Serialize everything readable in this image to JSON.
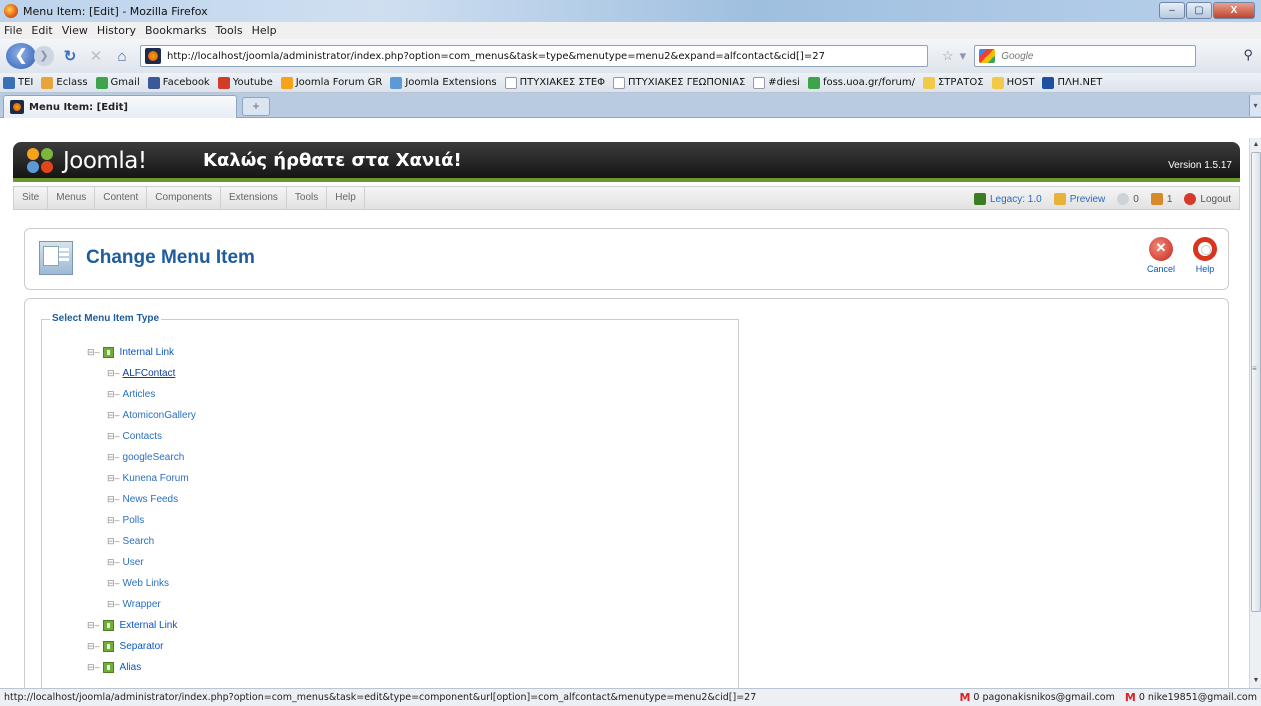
{
  "window": {
    "title": "Menu Item: [Edit] - Mozilla Firefox",
    "controls": [
      "–",
      "▢",
      "X"
    ]
  },
  "menubar": [
    "File",
    "Edit",
    "View",
    "History",
    "Bookmarks",
    "Tools",
    "Help"
  ],
  "navbar": {
    "url": "http://localhost/joomla/administrator/index.php?option=com_menus&task=type&menutype=menu2&expand=alfcontact&cid[]=27",
    "search_placeholder": "Google"
  },
  "bookmarks": [
    {
      "label": "TEI",
      "color": "#3b6fb6"
    },
    {
      "label": "Eclass",
      "color": "#e8a33b"
    },
    {
      "label": "Gmail",
      "color": "#3ea34a"
    },
    {
      "label": "Facebook",
      "color": "#3b5998"
    },
    {
      "label": "Youtube",
      "color": "#d23a2a"
    },
    {
      "label": "Joomla Forum GR",
      "color": "#f6a21a"
    },
    {
      "label": "Joomla Extensions",
      "color": "#5b9ad4"
    },
    {
      "label": "ΠΤΥΧΙΑΚΕΣ ΣΤΕΦ",
      "color": "#ffffff"
    },
    {
      "label": "ΠΤΥΧΙΑΚΕΣ ΓΕΩΠΟΝΙΑΣ",
      "color": "#ffffff"
    },
    {
      "label": "#diesi",
      "color": "#ffffff"
    },
    {
      "label": "foss.uoa.gr/forum/",
      "color": "#3ea34a"
    },
    {
      "label": "ΣΤΡΑΤΟΣ",
      "color": "#f3c94a"
    },
    {
      "label": "HOST",
      "color": "#f3c94a"
    },
    {
      "label": "ΠΛΗ.ΝΕΤ",
      "color": "#1f4fa0"
    }
  ],
  "tab": {
    "label": "Menu Item: [Edit]",
    "new_tab": "+"
  },
  "joomla": {
    "logo": "Joomla!",
    "site_name": "Καλώς ήρθατε στα Χανιά!",
    "version": "Version 1.5.17",
    "menu": [
      "Site",
      "Menus",
      "Content",
      "Components",
      "Extensions",
      "Tools",
      "Help"
    ],
    "status": {
      "legacy": "Legacy: 1.0",
      "preview": "Preview",
      "messages": "0",
      "users": "1",
      "logout": "Logout"
    }
  },
  "toolbar": {
    "title": "Change Menu Item",
    "cancel": "Cancel",
    "help": "Help"
  },
  "panel": {
    "legend": "Select Menu Item Type",
    "tree": {
      "internal": "Internal Link",
      "children": [
        "ALFContact",
        "Articles",
        "AtomiconGallery",
        "Contacts",
        "googleSearch",
        "Kunena Forum",
        "News Feeds",
        "Polls",
        "Search",
        "User",
        "Web Links",
        "Wrapper"
      ],
      "external": "External Link",
      "separator": "Separator",
      "alias": "Alias"
    }
  },
  "statusbar": {
    "link": "http://localhost/joomla/administrator/index.php?option=com_menus&task=edit&type=component&url[option]=com_alfcontact&menutype=menu2&cid[]=27",
    "gmail1": "0 pagonakisnikos@gmail.com",
    "gmail2": "0 nike19851@gmail.com"
  }
}
